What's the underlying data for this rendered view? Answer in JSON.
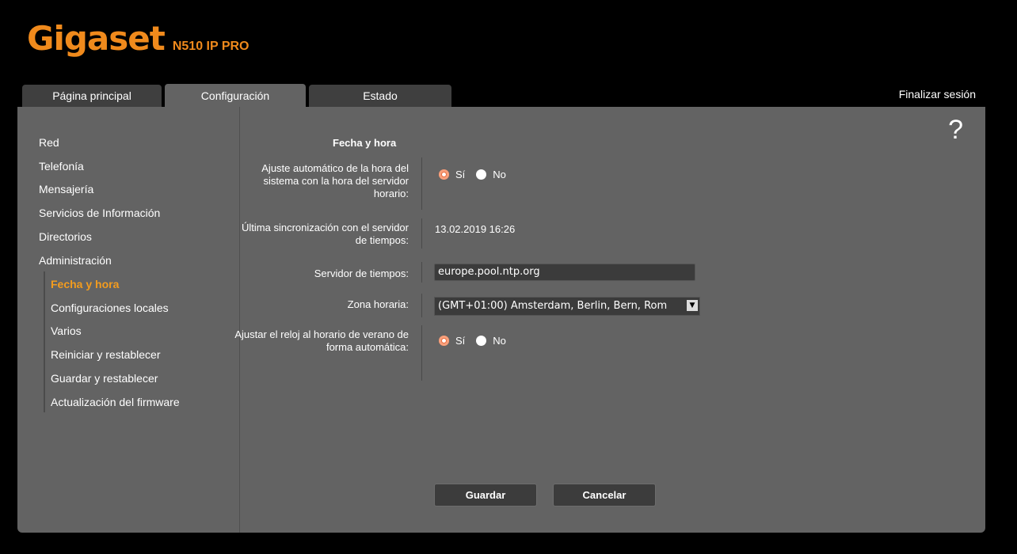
{
  "brand": {
    "name": "Gigaset",
    "model": "N510 IP PRO"
  },
  "tabs": [
    {
      "label": "Página principal"
    },
    {
      "label": "Configuración"
    },
    {
      "label": "Estado"
    }
  ],
  "logout_label": "Finalizar sesión",
  "help_symbol": "?",
  "sidebar": {
    "items": [
      "Red",
      "Telefonía",
      "Mensajería",
      "Servicios de Información",
      "Directorios",
      "Administración"
    ],
    "subitems": [
      "Fecha y hora",
      "Configuraciones locales",
      "Varios",
      "Reiniciar y restablecer",
      "Guardar y restablecer",
      "Actualización del firmware"
    ]
  },
  "form": {
    "title": "Fecha y hora",
    "auto_time": {
      "label": "Ajuste automático de la hora del sistema con la hora del servidor horario:",
      "yes": "Sí",
      "no": "No",
      "selected": "yes"
    },
    "last_sync": {
      "label": "Última sincronización con el servidor de tiempos:",
      "value": "13.02.2019 16:26"
    },
    "time_server": {
      "label": "Servidor de tiempos:",
      "value": "europe.pool.ntp.org"
    },
    "timezone": {
      "label": "Zona horaria:",
      "value": "(GMT+01:00) Amsterdam, Berlin, Bern, Rom"
    },
    "dst": {
      "label": "Ajustar el reloj al horario de verano de forma automática:",
      "yes": "Sí",
      "no": "No",
      "selected": "yes"
    },
    "save_label": "Guardar",
    "cancel_label": "Cancelar"
  },
  "colors": {
    "accent": "#f08a1c",
    "panel": "#636363",
    "tab_inactive": "#3f3f3f"
  }
}
